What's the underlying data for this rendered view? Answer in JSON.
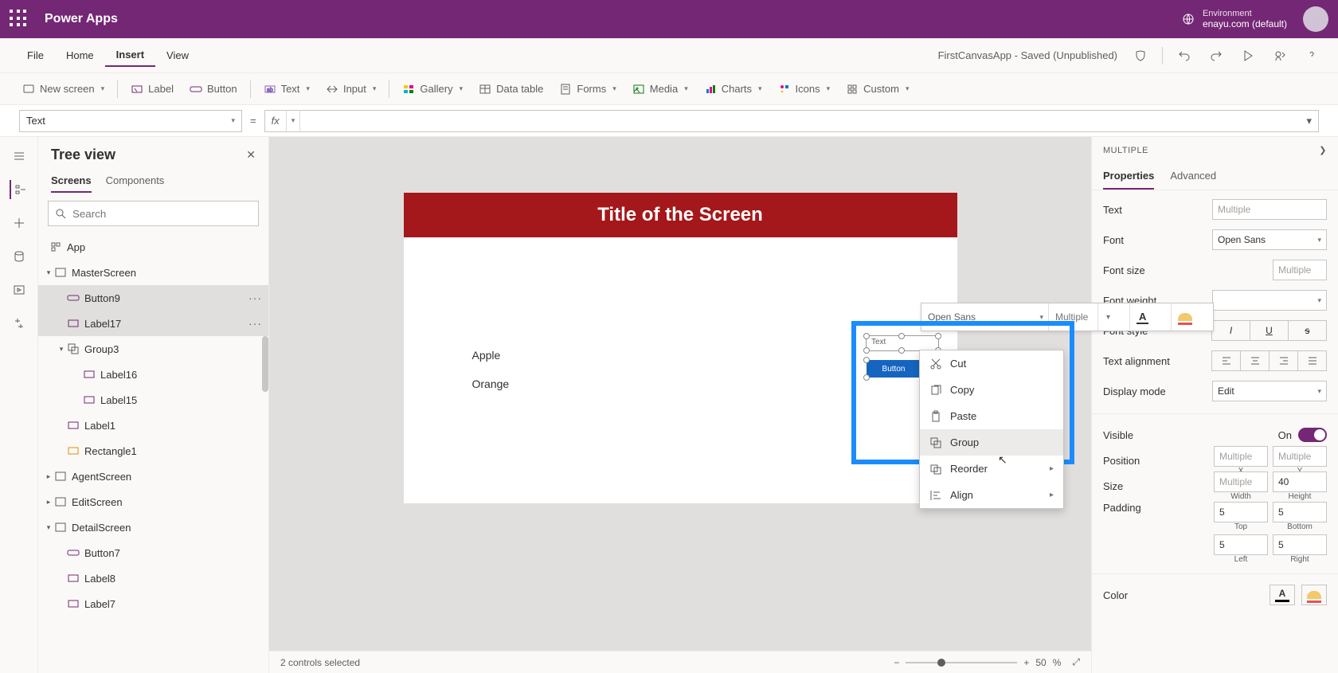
{
  "header": {
    "app": "Power Apps",
    "env_label": "Environment",
    "env_value": "enayu.com (default)"
  },
  "menu": {
    "items": [
      "File",
      "Home",
      "Insert",
      "View"
    ],
    "active": "Insert",
    "doc_title": "FirstCanvasApp - Saved (Unpublished)"
  },
  "insert_toolbar": {
    "new_screen": "New screen",
    "label": "Label",
    "button": "Button",
    "text": "Text",
    "input": "Input",
    "gallery": "Gallery",
    "data_table": "Data table",
    "forms": "Forms",
    "media": "Media",
    "charts": "Charts",
    "icons": "Icons",
    "custom": "Custom"
  },
  "formula": {
    "property": "Text",
    "equals": "=",
    "fx": "fx"
  },
  "tree": {
    "title": "Tree view",
    "tabs": {
      "screens": "Screens",
      "components": "Components"
    },
    "search_placeholder": "Search",
    "nodes": {
      "app": "App",
      "master": "MasterScreen",
      "button9": "Button9",
      "label17": "Label17",
      "group3": "Group3",
      "label16": "Label16",
      "label15": "Label15",
      "label1": "Label1",
      "rectangle1": "Rectangle1",
      "agent": "AgentScreen",
      "edit": "EditScreen",
      "detail": "DetailScreen",
      "button7": "Button7",
      "label8": "Label8",
      "label7": "Label7"
    }
  },
  "canvas": {
    "title": "Title of the Screen",
    "labels": {
      "apple": "Apple",
      "orange": "Orange"
    },
    "font_toolbar": {
      "font": "Open Sans",
      "size_placeholder": "Multiple"
    },
    "text_tag": "Text",
    "button_tag": "Button"
  },
  "context_menu": {
    "cut": "Cut",
    "copy": "Copy",
    "paste": "Paste",
    "group": "Group",
    "reorder": "Reorder",
    "align": "Align"
  },
  "status": {
    "selected": "2 controls selected",
    "zoom_value": "50",
    "zoom_unit": "%"
  },
  "props": {
    "head": "MULTIPLE",
    "tabs": {
      "properties": "Properties",
      "advanced": "Advanced"
    },
    "text": {
      "label": "Text",
      "value": "Multiple"
    },
    "font": {
      "label": "Font",
      "value": "Open Sans"
    },
    "font_size": {
      "label": "Font size",
      "value": "Multiple"
    },
    "font_weight": {
      "label": "Font weight"
    },
    "font_style": {
      "label": "Font style"
    },
    "text_align": {
      "label": "Text alignment"
    },
    "display_mode": {
      "label": "Display mode",
      "value": "Edit"
    },
    "visible": {
      "label": "Visible",
      "value": "On"
    },
    "position": {
      "label": "Position",
      "x": "Multiple",
      "y": "Multiple",
      "xl": "X",
      "yl": "Y"
    },
    "size": {
      "label": "Size",
      "w": "Multiple",
      "h": "40",
      "wl": "Width",
      "hl": "Height"
    },
    "padding": {
      "label": "Padding",
      "t": "5",
      "b": "5",
      "l": "5",
      "r": "5",
      "tl": "Top",
      "bl": "Bottom",
      "ll": "Left",
      "rl": "Right"
    },
    "color": {
      "label": "Color"
    }
  }
}
